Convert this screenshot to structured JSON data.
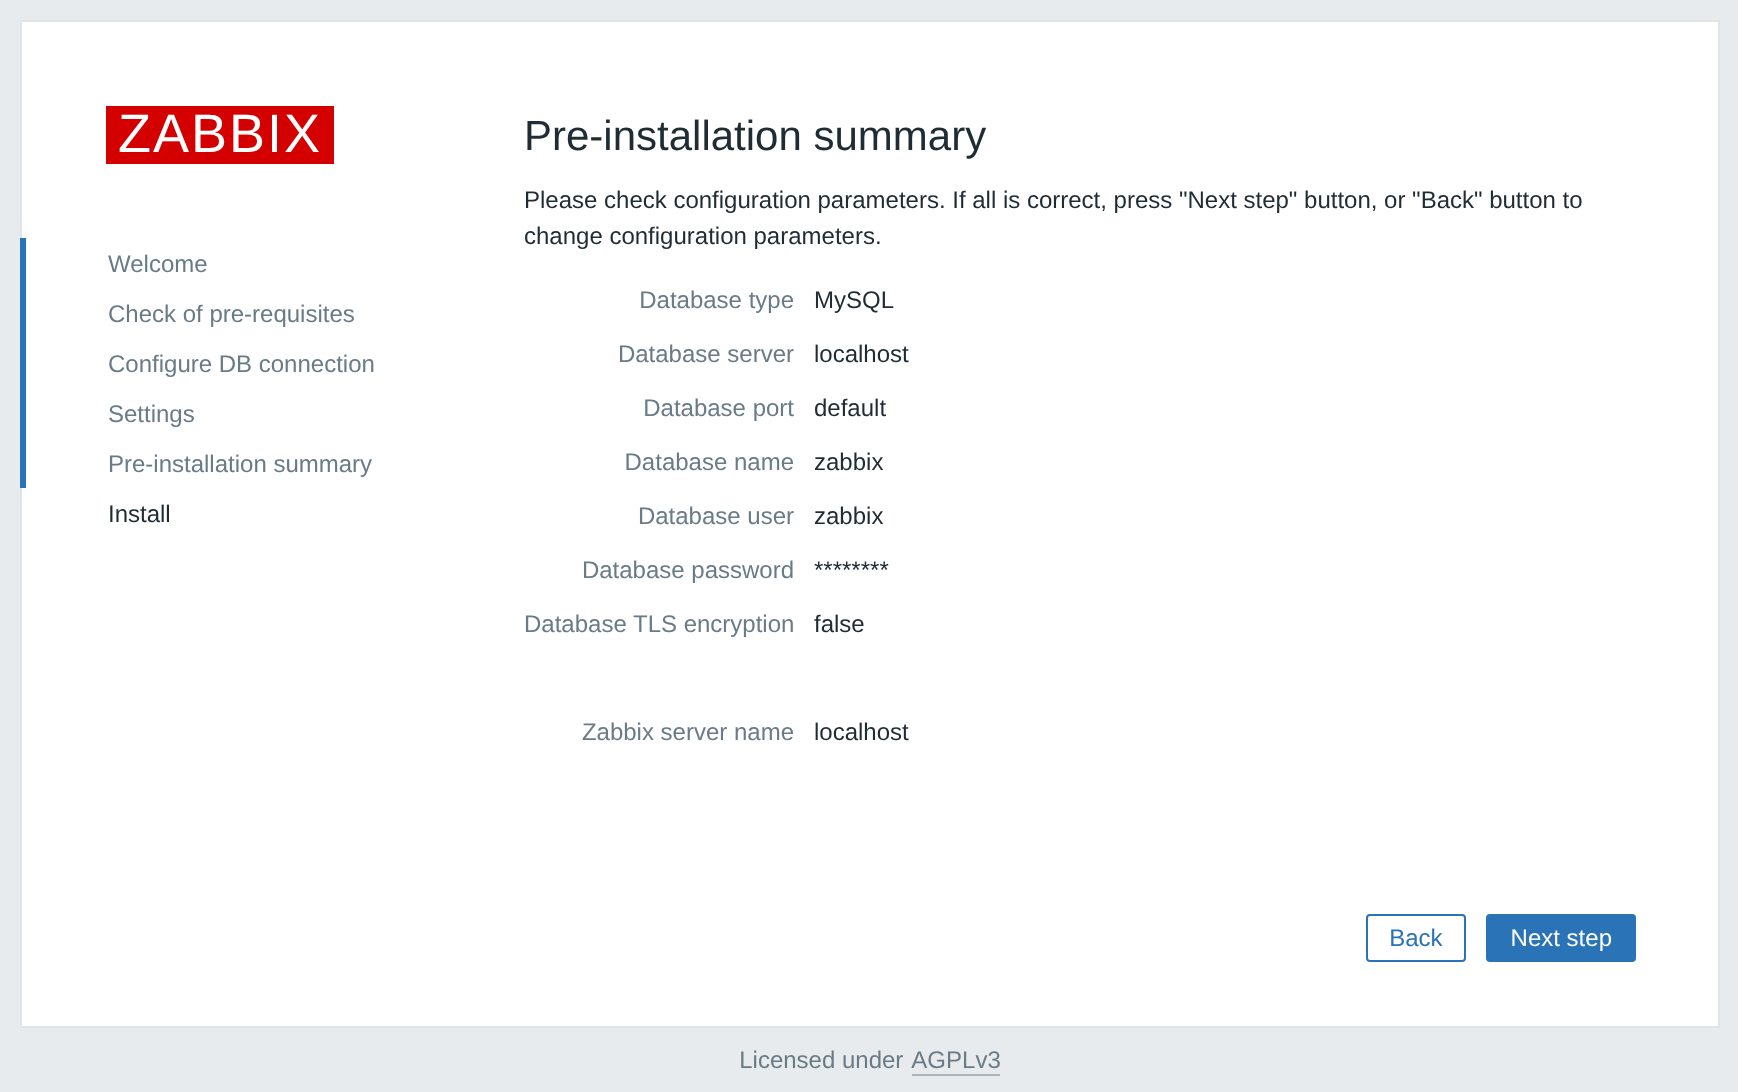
{
  "logo": "ZABBIX",
  "steps": [
    {
      "label": "Welcome",
      "completed": true
    },
    {
      "label": "Check of pre-requisites",
      "completed": true
    },
    {
      "label": "Configure DB connection",
      "completed": true
    },
    {
      "label": "Settings",
      "completed": true
    },
    {
      "label": "Pre-installation summary",
      "completed": true
    },
    {
      "label": "Install",
      "completed": false
    }
  ],
  "title": "Pre-installation summary",
  "intro": "Please check configuration parameters. If all is correct, press \"Next step\" button, or \"Back\" button to change configuration parameters.",
  "groups": [
    [
      {
        "label": "Database type",
        "value": "MySQL"
      },
      {
        "label": "Database server",
        "value": "localhost"
      },
      {
        "label": "Database port",
        "value": "default"
      },
      {
        "label": "Database name",
        "value": "zabbix"
      },
      {
        "label": "Database user",
        "value": "zabbix"
      },
      {
        "label": "Database password",
        "value": "********"
      },
      {
        "label": "Database TLS encryption",
        "value": "false"
      }
    ],
    [
      {
        "label": "Zabbix server name",
        "value": "localhost"
      }
    ]
  ],
  "buttons": [
    {
      "label": "Back",
      "kind": "secondary"
    },
    {
      "label": "Next step",
      "kind": "primary"
    }
  ],
  "footer": {
    "text": "Licensed under",
    "link": "AGPLv3"
  }
}
